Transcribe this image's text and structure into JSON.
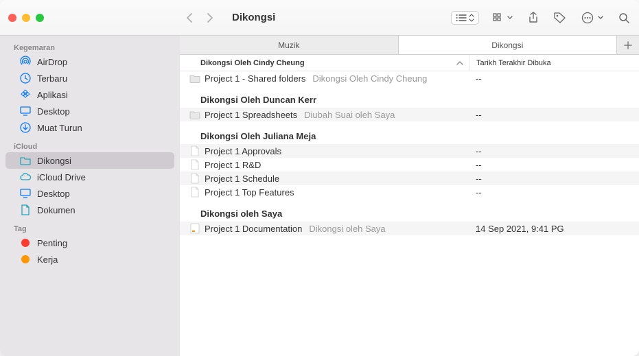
{
  "window": {
    "title": "Dikongsi"
  },
  "sidebar": {
    "sections": [
      {
        "heading": "Kegemaran",
        "items": [
          {
            "label": "AirDrop",
            "icon": "airdrop"
          },
          {
            "label": "Terbaru",
            "icon": "clock"
          },
          {
            "label": "Aplikasi",
            "icon": "apps"
          },
          {
            "label": "Desktop",
            "icon": "desktop"
          },
          {
            "label": "Muat Turun",
            "icon": "download"
          }
        ]
      },
      {
        "heading": "iCloud",
        "items": [
          {
            "label": "Dikongsi",
            "icon": "shared-folder",
            "selected": true
          },
          {
            "label": "iCloud Drive",
            "icon": "cloud"
          },
          {
            "label": "Desktop",
            "icon": "desktop"
          },
          {
            "label": "Dokumen",
            "icon": "document"
          }
        ]
      },
      {
        "heading": "Tag",
        "items": [
          {
            "label": "Penting",
            "icon": "tag",
            "color": "#ff3b30"
          },
          {
            "label": "Kerja",
            "icon": "tag",
            "color": "#ff9500"
          }
        ]
      }
    ]
  },
  "tabs": [
    {
      "label": "Muzik",
      "active": false
    },
    {
      "label": "Dikongsi",
      "active": true
    }
  ],
  "columns": {
    "name": "Dikongsi Oleh Cindy Cheung",
    "date": "Tarikh Terakhir Dibuka"
  },
  "groups": [
    {
      "header": null,
      "rows": [
        {
          "icon": "folder",
          "name": "Project 1 - Shared folders",
          "sub": "Dikongsi Oleh Cindy Cheung",
          "date": "--",
          "alt": false
        }
      ]
    },
    {
      "header": "Dikongsi Oleh Duncan Kerr",
      "rows": [
        {
          "icon": "folder",
          "name": "Project 1 Spreadsheets",
          "sub": "Diubah Suai oleh Saya",
          "date": "--",
          "alt": true
        }
      ]
    },
    {
      "header": "Dikongsi Oleh Juliana Meja",
      "rows": [
        {
          "icon": "doc",
          "name": "Project 1 Approvals",
          "sub": "",
          "date": "--",
          "alt": true
        },
        {
          "icon": "doc",
          "name": "Project 1 R&D",
          "sub": "",
          "date": "--",
          "alt": false
        },
        {
          "icon": "doc",
          "name": "Project 1 Schedule",
          "sub": "",
          "date": "--",
          "alt": true
        },
        {
          "icon": "doc",
          "name": "Project 1 Top Features",
          "sub": "",
          "date": "--",
          "alt": false
        }
      ]
    },
    {
      "header": "Dikongsi oleh Saya",
      "rows": [
        {
          "icon": "pages",
          "name": "Project 1 Documentation",
          "sub": "Dikongsi oleh Saya",
          "date": "14 Sep 2021, 9:41 PG",
          "alt": true
        }
      ]
    }
  ]
}
